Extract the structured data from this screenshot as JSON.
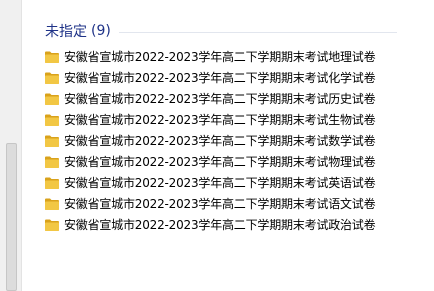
{
  "group": {
    "title": "未指定",
    "count": "(9)"
  },
  "files": [
    {
      "name": "安徽省宣城市2022-2023学年高二下学期期末考试地理试卷",
      "icon": "folder-icon"
    },
    {
      "name": "安徽省宣城市2022-2023学年高二下学期期末考试化学试卷",
      "icon": "folder-icon"
    },
    {
      "name": "安徽省宣城市2022-2023学年高二下学期期末考试历史试卷",
      "icon": "folder-icon"
    },
    {
      "name": "安徽省宣城市2022-2023学年高二下学期期末考试生物试卷",
      "icon": "folder-icon"
    },
    {
      "name": "安徽省宣城市2022-2023学年高二下学期期末考试数学试卷",
      "icon": "folder-icon"
    },
    {
      "name": "安徽省宣城市2022-2023学年高二下学期期末考试物理试卷",
      "icon": "folder-icon"
    },
    {
      "name": "安徽省宣城市2022-2023学年高二下学期期末考试英语试卷",
      "icon": "folder-icon"
    },
    {
      "name": "安徽省宣城市2022-2023学年高二下学期期末考试语文试卷",
      "icon": "folder-icon"
    },
    {
      "name": "安徽省宣城市2022-2023学年高二下学期期末考试政治试卷",
      "icon": "folder-icon"
    }
  ],
  "colors": {
    "group_header": "#1e3287",
    "folder_fill": "#f2c744",
    "folder_dark": "#d9a21b"
  }
}
